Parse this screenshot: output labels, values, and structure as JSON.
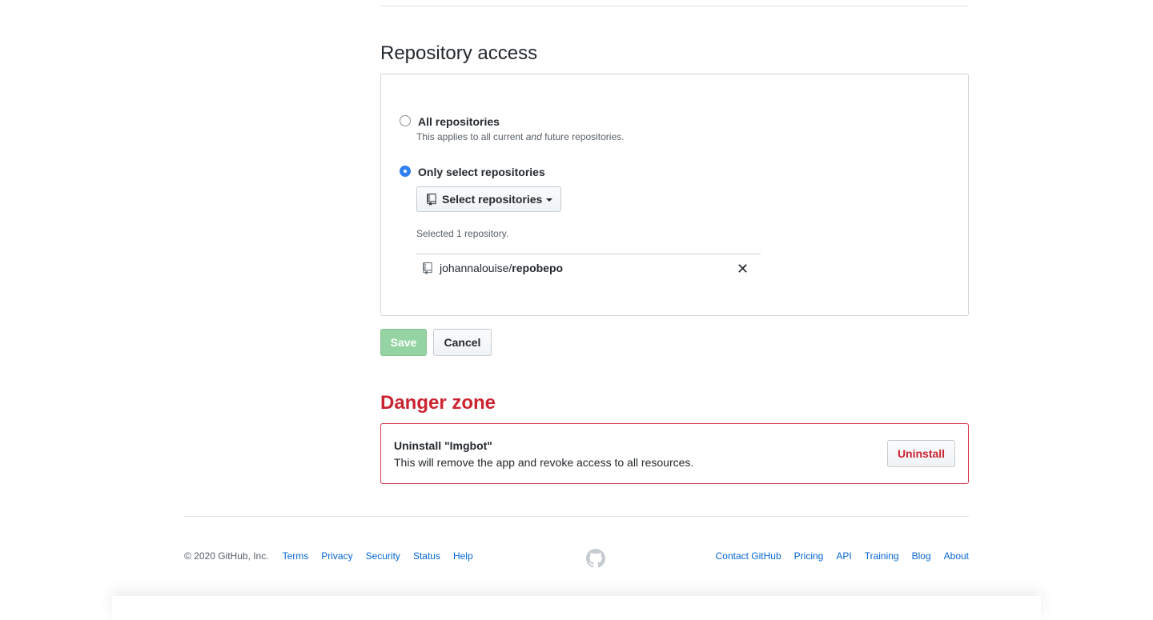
{
  "repo_access": {
    "title": "Repository access",
    "options": [
      {
        "label": "All repositories",
        "note_pre": "This applies to all current ",
        "note_em": "and",
        "note_post": " future repositories.",
        "checked": false
      },
      {
        "label": "Only select repositories",
        "checked": true
      }
    ],
    "select_button_label": "Select repositories",
    "selected_count_text": "Selected 1 repository.",
    "selected_repos": [
      {
        "owner": "johannalouise/",
        "name": "repobepo",
        "remove_glyph": "✕"
      }
    ]
  },
  "actions": {
    "save_label": "Save",
    "cancel_label": "Cancel"
  },
  "danger_zone": {
    "title": "Danger zone",
    "heading": "Uninstall \"Imgbot\"",
    "description": "This will remove the app and revoke access to all resources.",
    "uninstall_label": "Uninstall"
  },
  "footer": {
    "copyright": "© 2020 GitHub, Inc.",
    "left_links": [
      "Terms",
      "Privacy",
      "Security",
      "Status",
      "Help"
    ],
    "right_links": [
      "Contact GitHub",
      "Pricing",
      "API",
      "Training",
      "Blog",
      "About"
    ]
  },
  "colors": {
    "accent_blue": "#0366d6",
    "radio_checked": "#2f7ff5",
    "danger_red": "#cb2431",
    "save_disabled_green": "#94d3a2"
  },
  "icons": [
    "repo-icon",
    "caret-down-icon",
    "close-icon",
    "github-mark-icon"
  ]
}
